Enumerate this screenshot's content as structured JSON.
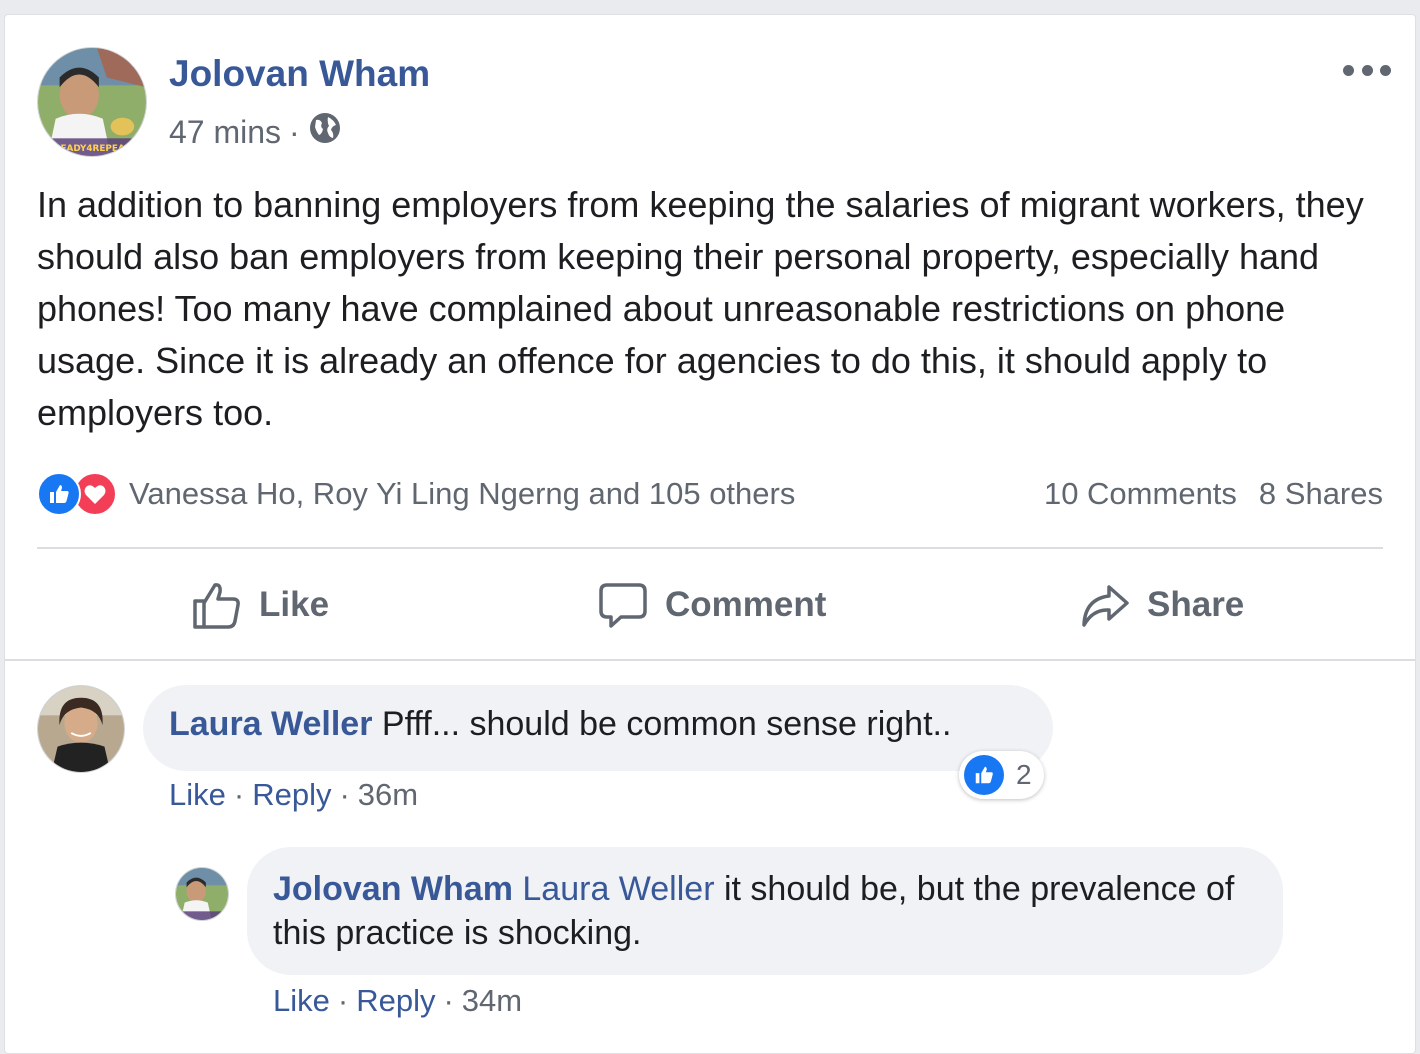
{
  "post": {
    "author": "Jolovan Wham",
    "time": "47 mins",
    "separator": "·",
    "privacy_icon": "globe-icon",
    "avatar_caption": "READY4REPEAL",
    "text": "In addition to banning employers from keeping the salaries of migrant workers, they should also ban employers from keeping their personal property, especially hand phones! Too many have complained about unreasonable restrictions on phone usage. Since it is already an offence for agencies to do this, it should apply to employers too.",
    "reactions": {
      "icons": [
        "like-icon",
        "love-icon"
      ],
      "names": "Vanessa Ho, Roy Yi Ling Ngerng and 105 others"
    },
    "comments_count": "10 Comments",
    "shares_count": "8 Shares"
  },
  "actions": {
    "like": "Like",
    "comment": "Comment",
    "share": "Share"
  },
  "comments": [
    {
      "author": "Laura Weller",
      "text": "Pfff... should be common sense right..",
      "like": "Like",
      "reply": "Reply",
      "sep": "·",
      "time": "36m",
      "reaction_count": "2"
    },
    {
      "author": "Jolovan Wham",
      "tag": "Laura Weller",
      "text": "it should be, but the prevalence of this practice is shocking.",
      "like": "Like",
      "reply": "Reply",
      "sep": "·",
      "time": "34m"
    }
  ],
  "colors": {
    "link": "#385898",
    "secondary": "#606770",
    "like_blue": "#1877f2",
    "love_red": "#f33e58",
    "bubble": "#f0f2f5"
  }
}
